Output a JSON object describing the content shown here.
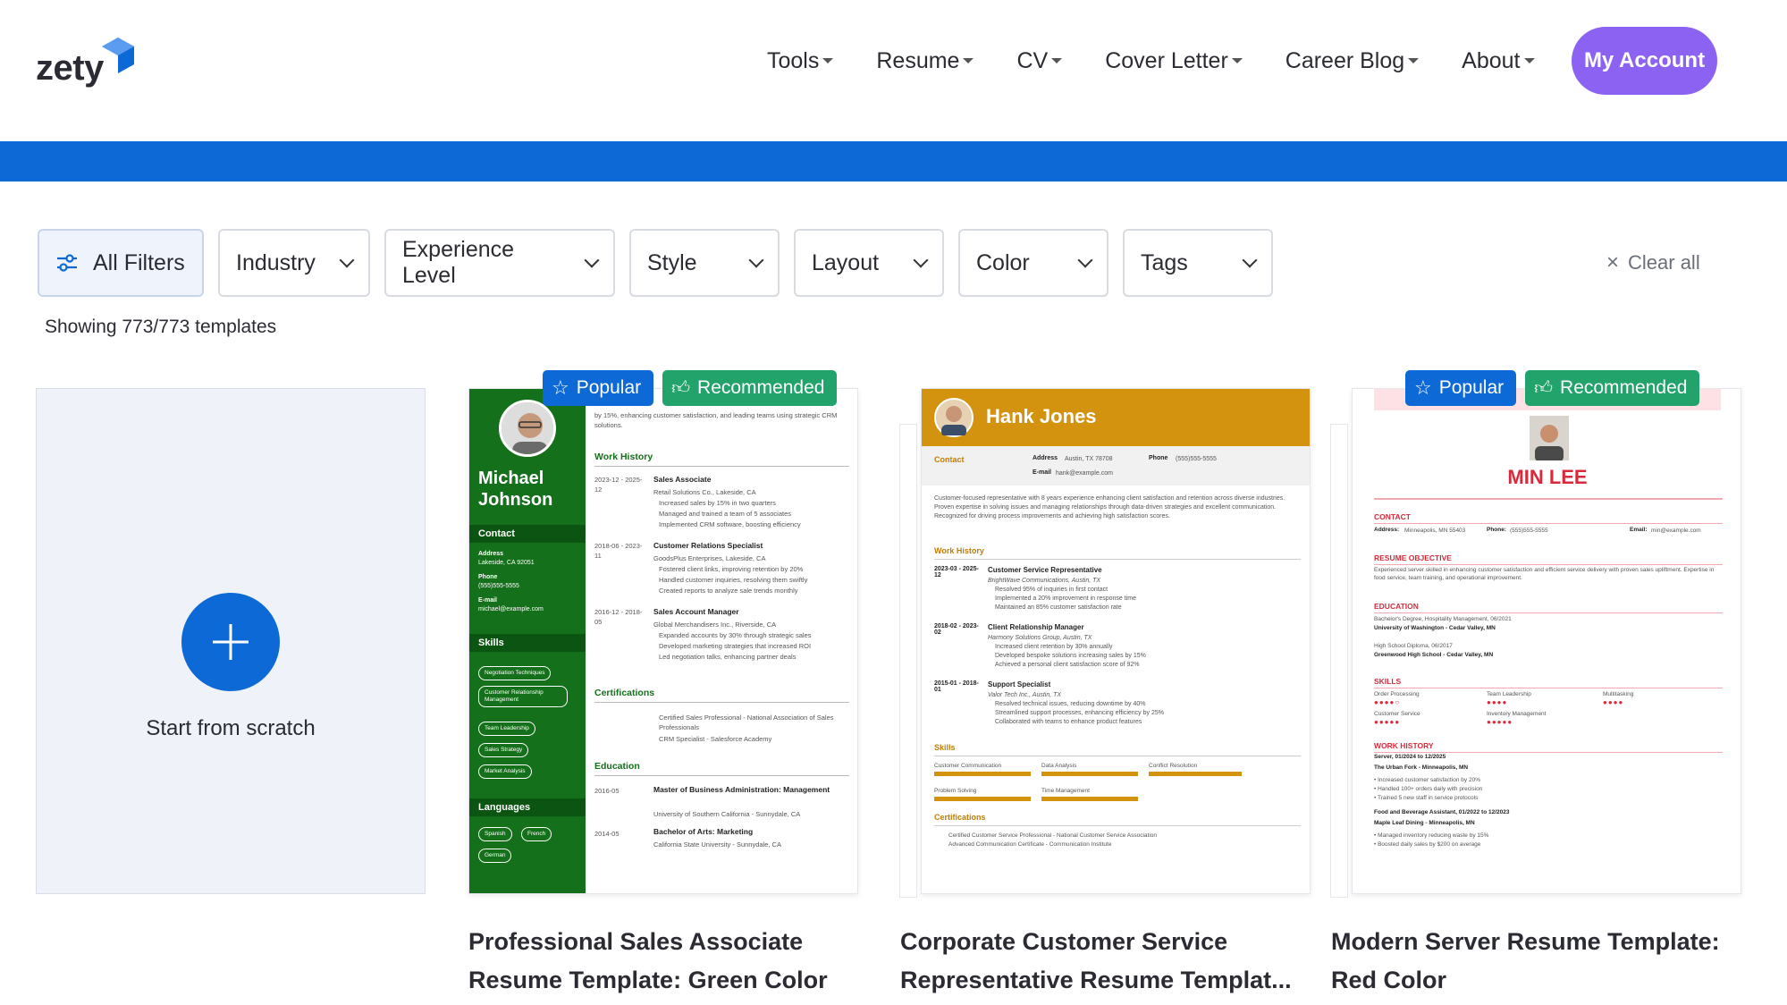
{
  "brand": {
    "logo_text": "zety",
    "accent": "#0d69d6",
    "account_color": "#8c62f3"
  },
  "nav": {
    "items": [
      {
        "label": "Tools"
      },
      {
        "label": "Resume"
      },
      {
        "label": "CV"
      },
      {
        "label": "Cover Letter"
      },
      {
        "label": "Career Blog"
      },
      {
        "label": "About"
      }
    ],
    "account_label": "My Account"
  },
  "filters": {
    "all_label": "All Filters",
    "items": [
      {
        "label": "Industry"
      },
      {
        "label": "Experience Level"
      },
      {
        "label": "Style"
      },
      {
        "label": "Layout"
      },
      {
        "label": "Color"
      },
      {
        "label": "Tags"
      }
    ],
    "clear_label": "Clear all",
    "showing": "Showing 773/773 templates"
  },
  "scratch": {
    "label": "Start from scratch"
  },
  "templates": [
    {
      "title": "Professional Sales Associate Resume Template: Green Color",
      "badges": [
        "Popular",
        "Recommended"
      ],
      "preview": {
        "name_first": "Michael",
        "name_last": "Johnson",
        "contact_h": "Contact",
        "address_label": "Address",
        "address": "Lakeside, CA 92051",
        "phone_label": "Phone",
        "phone": "(555)555-5555",
        "email_label": "E-mail",
        "email": "michael@example.com",
        "skills_h": "Skills",
        "skills": [
          "Negotiation Techniques",
          "Customer Relationship Management",
          "Team Leadership",
          "Sales Strategy",
          "Market Analysis"
        ],
        "languages_h": "Languages",
        "languages": [
          "Spanish",
          "French",
          "German"
        ],
        "summary": "by 15%, enhancing customer satisfaction, and leading teams using strategic CRM solutions.",
        "work_h": "Work History",
        "jobs": [
          {
            "dates": "2023-12 - 2025-12",
            "title": "Sales Associate",
            "company": "Retail Solutions Co., Lakeside, CA",
            "bullets": [
              "Increased sales by 15% in two quarters",
              "Managed and trained a team of 5 associates",
              "Implemented CRM software, boosting efficiency"
            ]
          },
          {
            "dates": "2018-06 - 2023-11",
            "title": "Customer Relations Specialist",
            "company": "GoodsPlus Enterprises, Lakeside, CA",
            "bullets": [
              "Fostered client links, improving retention by 20%",
              "Handled customer inquiries, resolving them swiftly",
              "Created reports to analyze sale trends monthly"
            ]
          },
          {
            "dates": "2016-12 - 2018-05",
            "title": "Sales Account Manager",
            "company": "Global Merchandisers Inc., Riverside, CA",
            "bullets": [
              "Expanded accounts by 30% through strategic sales",
              "Developed marketing strategies that increased ROI",
              "Led negotiation talks, enhancing partner deals"
            ]
          }
        ],
        "cert_h": "Certifications",
        "certs": [
          "Certified Sales Professional - National Association of Sales Professionals",
          "CRM Specialist - Salesforce Academy"
        ],
        "edu_h": "Education",
        "edu": [
          {
            "year": "2016-05",
            "degree": "Master of Business Administration: Management",
            "school": "University of Southern California - Sunnydale, CA"
          },
          {
            "year": "2014-05",
            "degree": "Bachelor of Arts: Marketing",
            "school": "California State University - Sunnydale, CA"
          }
        ]
      }
    },
    {
      "title": "Corporate Customer Service Representative Resume Templat...",
      "badges": [],
      "preview": {
        "name": "Hank Jones",
        "contact_h": "Contact",
        "address_label": "Address",
        "address": "Austin, TX 78708",
        "phone_label": "Phone",
        "phone": "(555)555-5555",
        "email_label": "E-mail",
        "email": "hank@example.com",
        "summary": "Customer-focused representative with 8 years experience enhancing client satisfaction and retention across diverse industries. Proven expertise in solving issues and managing relationships through data-driven strategies and excellent communication. Recognized for driving process improvements and achieving high satisfaction scores.",
        "work_h": "Work History",
        "jobs": [
          {
            "dates": "2023-03 - 2025-12",
            "title": "Customer Service Representative",
            "company": "BrightWave Communications, Austin, TX",
            "bullets": [
              "Resolved 95% of inquiries in first contact",
              "Implemented a 20% improvement in response time",
              "Maintained an 85% customer satisfaction rate"
            ]
          },
          {
            "dates": "2018-02 - 2023-02",
            "title": "Client Relationship Manager",
            "company": "Harmony Solutions Group, Austin, TX",
            "bullets": [
              "Increased client retention by 30% annually",
              "Developed bespoke solutions increasing sales by 15%",
              "Achieved a personal client satisfaction score of 92%"
            ]
          },
          {
            "dates": "2015-01 - 2018-01",
            "title": "Support Specialist",
            "company": "Valor Tech Inc., Austin, TX",
            "bullets": [
              "Resolved technical issues, reducing downtime by 40%",
              "Streamlined support processes, enhancing efficiency by 25%",
              "Collaborated with teams to enhance product features"
            ]
          }
        ],
        "skills_h": "Skills",
        "skills": [
          "Customer Communication",
          "Data Analysis",
          "Conflict Resolution",
          "Problem Solving",
          "Time Management"
        ],
        "cert_h": "Certifications",
        "certs": [
          "Certified Customer Service Professional - National Customer Service Association",
          "Advanced Communication Certificate - Communication Institute"
        ]
      }
    },
    {
      "title": "Modern Server Resume Template: Red Color",
      "badges": [
        "Popular",
        "Recommended"
      ],
      "preview": {
        "name": "MIN LEE",
        "contact_h": "CONTACT",
        "address_label": "Address:",
        "address": "Minneapolis, MN 55403",
        "phone_label": "Phone:",
        "phone": "(555)555-5555",
        "email_label": "Email:",
        "email": "min@example.com",
        "objective_h": "RESUME OBJECTIVE",
        "objective": "Experienced server skilled in enhancing customer satisfaction and efficient service delivery with proven sales upliftment. Expertise in food service, team training, and operational improvement.",
        "edu_h": "EDUCATION",
        "edu": [
          "Bachelor's Degree, Hospitality Management, 06/2021",
          "University of Washington - Cedar Valley, MN",
          "High School Diploma, 06/2017",
          "Greenwood High School - Cedar Valley, MN"
        ],
        "skills_h": "SKILLS",
        "skills": [
          "Order Processing",
          "Team Leadership",
          "Multitasking",
          "Customer Service",
          "Inventory Management"
        ],
        "work_h": "WORK HISTORY",
        "work": [
          "Server, 01/2024 to 12/2025",
          "The Urban Fork - Minneapolis, MN",
          "• Increased customer satisfaction by 20%",
          "• Handled 100+ orders daily with precision",
          "• Trained 5 new staff in service protocols",
          "Food and Beverage Assistant, 01/2022 to 12/2023",
          "Maple Leaf Dining - Minneapolis, MN",
          "• Managed inventory reducing waste by 15%",
          "• Boosted daily sales by $200 on average"
        ]
      }
    }
  ]
}
